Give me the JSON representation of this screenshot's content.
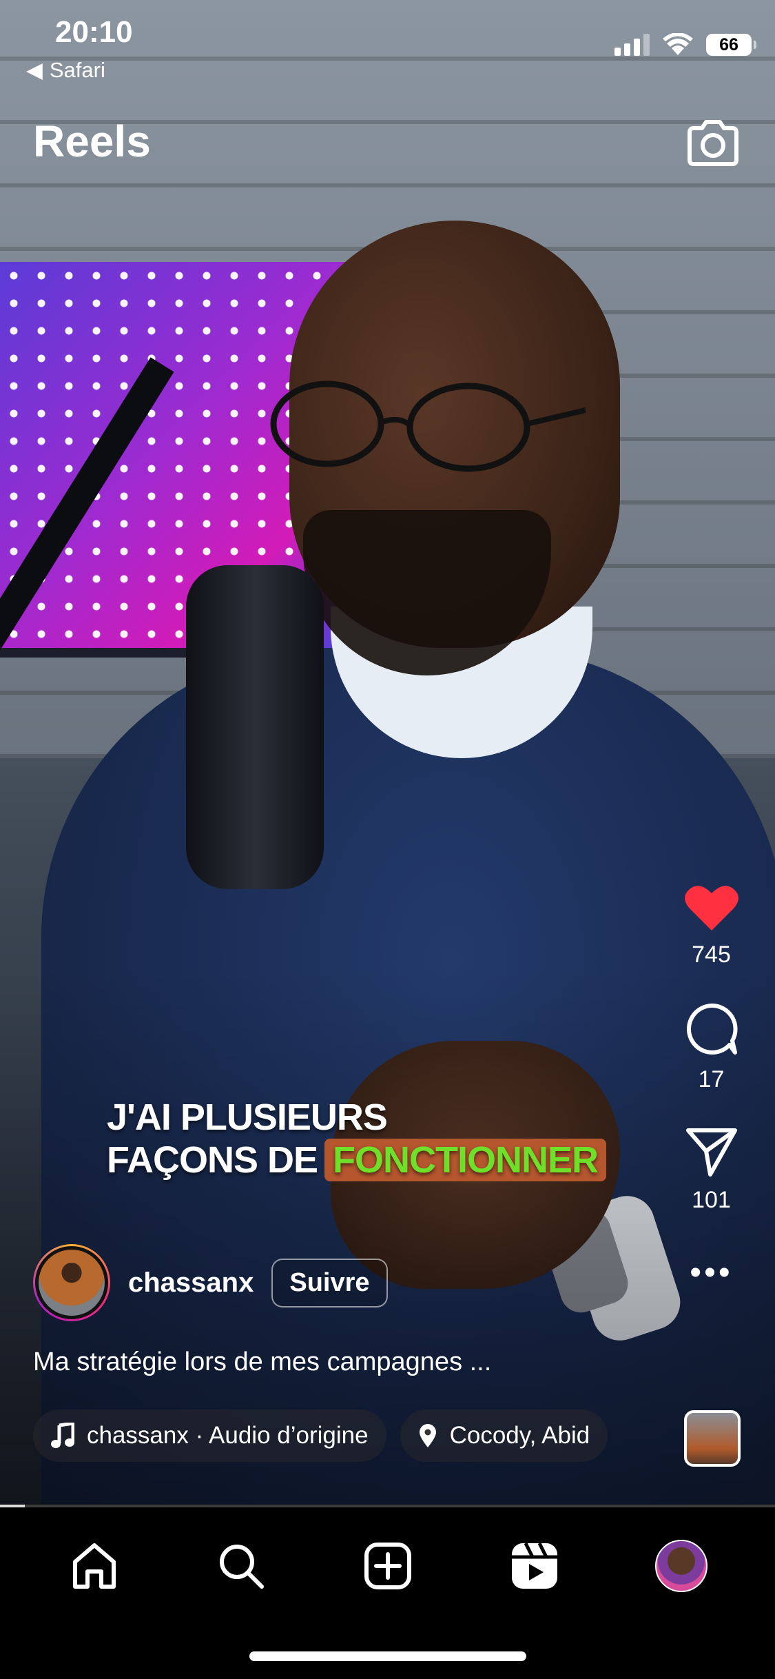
{
  "status_bar": {
    "time": "20:10",
    "back_app": "Safari",
    "battery": "66"
  },
  "header": {
    "title": "Reels",
    "camera_icon": "camera-icon"
  },
  "video": {
    "caption_line1": "J'AI PLUSIEURS",
    "caption_line2_prefix": "FAÇONS DE",
    "caption_highlight": "FONCTIONNER",
    "caption_highlight_bg": "#b5562f",
    "caption_highlight_color": "#6ee02a"
  },
  "actions": {
    "likes": "745",
    "comments": "17",
    "shares": "101",
    "like_color": "#ff3040"
  },
  "post": {
    "username": "chassanx",
    "follow_label": "Suivre",
    "description": "Ma stratégie lors de mes campagnes ...",
    "audio": "chassanx · Audio d’origine",
    "location": "Cocody, Abid"
  },
  "nav": {
    "items": [
      "home-icon",
      "search-icon",
      "create-icon",
      "reels-icon",
      "profile-avatar"
    ]
  }
}
